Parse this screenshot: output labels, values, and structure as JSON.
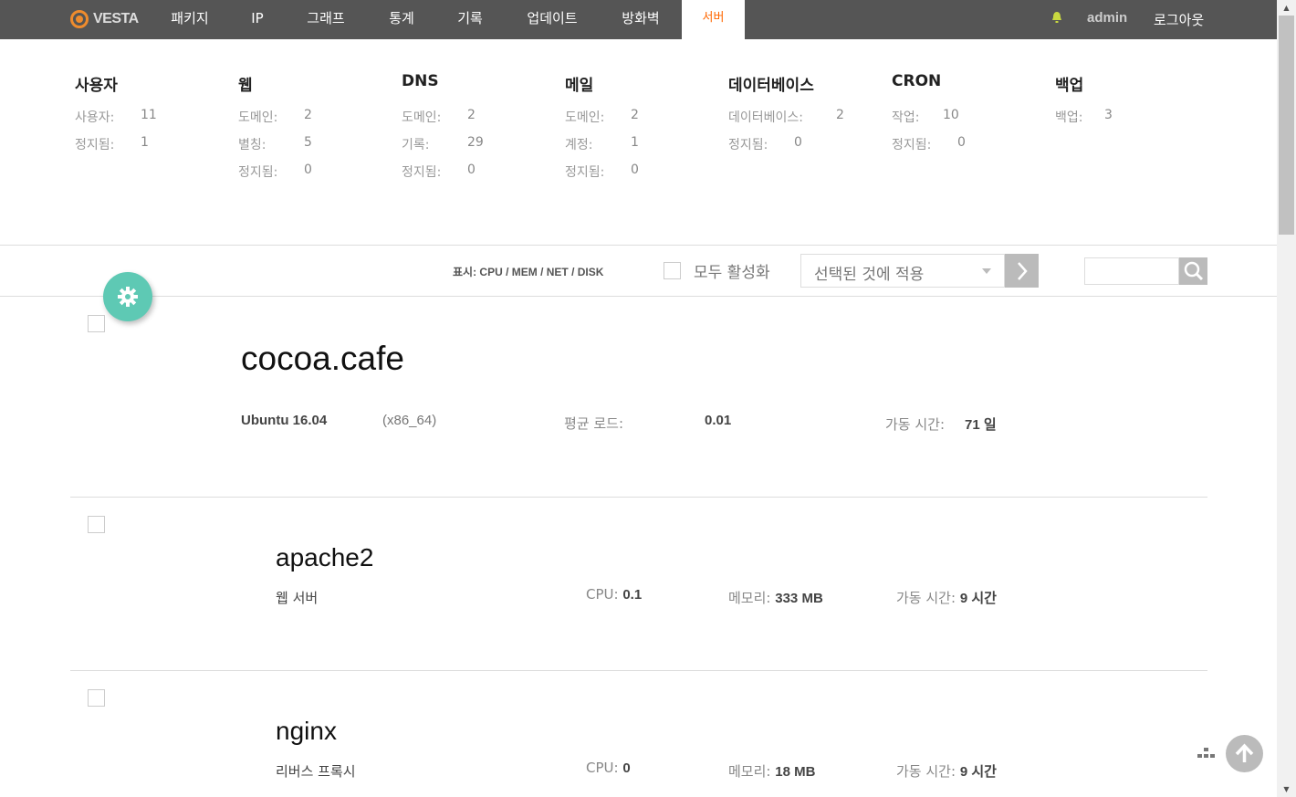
{
  "nav": {
    "logo": "VESTA",
    "items": [
      "패키지",
      "IP",
      "그래프",
      "통계",
      "기록",
      "업데이트",
      "방화벽",
      "서버"
    ],
    "user": "admin",
    "logout": "로그아웃"
  },
  "stats": [
    {
      "title": "사용자",
      "rows": [
        [
          "사용자:",
          "11"
        ],
        [
          "정지됨:",
          "1"
        ]
      ]
    },
    {
      "title": "웹",
      "rows": [
        [
          "도메인:",
          "2"
        ],
        [
          "별칭:",
          "5"
        ],
        [
          "정지됨:",
          "0"
        ]
      ]
    },
    {
      "title": "DNS",
      "rows": [
        [
          "도메인:",
          "2"
        ],
        [
          "기록:",
          "29"
        ],
        [
          "정지됨:",
          "0"
        ]
      ]
    },
    {
      "title": "메일",
      "rows": [
        [
          "도메인:",
          "2"
        ],
        [
          "계정:",
          "1"
        ],
        [
          "정지됨:",
          "0"
        ]
      ]
    },
    {
      "title": "데이터베이스",
      "rows": [
        [
          "데이터베이스:",
          "2"
        ],
        [
          "정지됨:",
          "0"
        ]
      ]
    },
    {
      "title": "CRON",
      "rows": [
        [
          "작업:",
          "10"
        ],
        [
          "정지됨:",
          "0"
        ]
      ]
    },
    {
      "title": "백업",
      "rows": [
        [
          "백업:",
          "3"
        ]
      ]
    }
  ],
  "toolbar": {
    "display": "표시: CPU / MEM / NET / DISK",
    "toggle_all": "모두 활성화",
    "apply_select": "선택된 것에 적용"
  },
  "server": {
    "hostname": "cocoa.cafe",
    "os": "Ubuntu 16.04",
    "arch": "(x86_64)",
    "load_label": "평균 로드:",
    "load_value": "0.01",
    "uptime_label": "가동 시간:",
    "uptime_value": "71 일"
  },
  "services": [
    {
      "name": "apache2",
      "desc": "웹 서버",
      "cpu_label": "CPU:",
      "cpu": "0.1",
      "mem_label": "메모리:",
      "mem": "333 MB",
      "up_label": "가동 시간:",
      "up": "9 시간"
    },
    {
      "name": "nginx",
      "desc": "리버스 프록시",
      "cpu_label": "CPU:",
      "cpu": "0",
      "mem_label": "메모리:",
      "mem": "18 MB",
      "up_label": "가동 시간:",
      "up": "9 시간"
    }
  ],
  "colors": {
    "topbar": "#555555",
    "active_tab": "#ff6701",
    "fab": "#5ec9b4"
  }
}
